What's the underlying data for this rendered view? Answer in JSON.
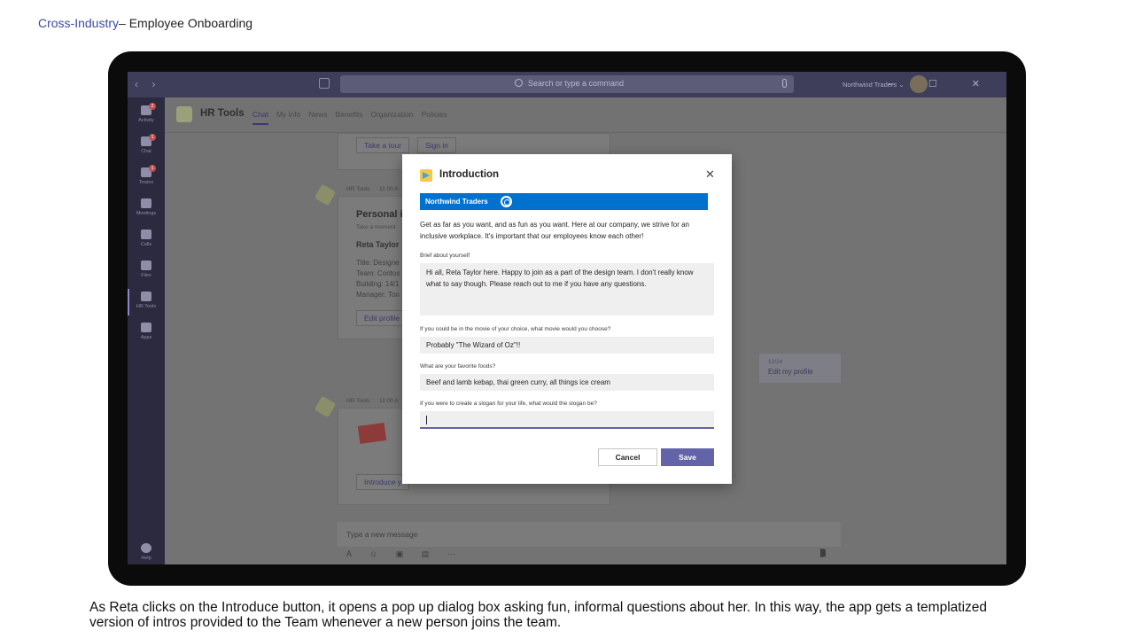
{
  "slide": {
    "title_accent": "Cross-Industry",
    "title_rest": "– Employee Onboarding",
    "caption": "As Reta clicks on the Introduce button, it opens a pop up dialog box asking fun, informal questions about her. In this way, the app gets a templatized version of intros provided to the Team whenever a new person joins the team."
  },
  "teams": {
    "search_placeholder": "Search or type a command",
    "org_name": "Northwind Traders ⌄",
    "rail": [
      {
        "label": "Activity",
        "badge": "2"
      },
      {
        "label": "Chat",
        "badge": "1"
      },
      {
        "label": "Teams",
        "badge": "1"
      },
      {
        "label": "Meetings",
        "badge": ""
      },
      {
        "label": "Calls",
        "badge": ""
      },
      {
        "label": "Files",
        "badge": ""
      },
      {
        "label": "HR Tools",
        "badge": ""
      },
      {
        "label": "Apps",
        "badge": ""
      }
    ],
    "help_label": "Help",
    "app_name": "HR Tools",
    "tabs": [
      "Chat",
      "My info",
      "News",
      "Benefits",
      "Organization",
      "Policies"
    ],
    "card1": {
      "btn_tour": "Take a tour",
      "btn_signin": "Sign in"
    },
    "msg1": {
      "sender": "HR Tools",
      "time": "11:00 A",
      "heading": "Personal i",
      "subtext": "Take a moment",
      "name": "Reta Taylor",
      "lines": [
        "Title: Designe",
        "Team: Contos",
        "Building: 14/1",
        "Manager: Ton"
      ],
      "button": "Edit profile"
    },
    "my_bubble": {
      "time": "12/24",
      "text": "Edit my profile"
    },
    "msg2": {
      "sender": "HR Tools",
      "time": "11:00 A",
      "button": "Introduce y"
    },
    "composer_placeholder": "Type a new message"
  },
  "dialog": {
    "title": "Introduction",
    "banner": "Northwind Traders",
    "intro": "Get as far as you want, and as fun as you want. Here at our company, we strive for an inclusive workplace. It's important that our employees know each other!",
    "q1_label": "Brief about yourself",
    "q1_value": "Hi all, Reta Taylor here. Happy to join as a part of the design team. I don't really know what to say though. Please reach out to me if you have any questions.",
    "q2_label": "If you could be in the movie of your choice, what movie would you choose?",
    "q2_value": "Probably \"The Wizard of Oz\"!!",
    "q3_label": "What are your favorite foods?",
    "q3_value": "Beef and lamb kebap, thai green curry, all things ice cream",
    "q4_label": "If you were to create a slogan for your life, what would the slogan be?",
    "q4_value": "",
    "cancel": "Cancel",
    "save": "Save",
    "colors": {
      "banner": "#0071cc",
      "primary": "#6264a7"
    }
  }
}
